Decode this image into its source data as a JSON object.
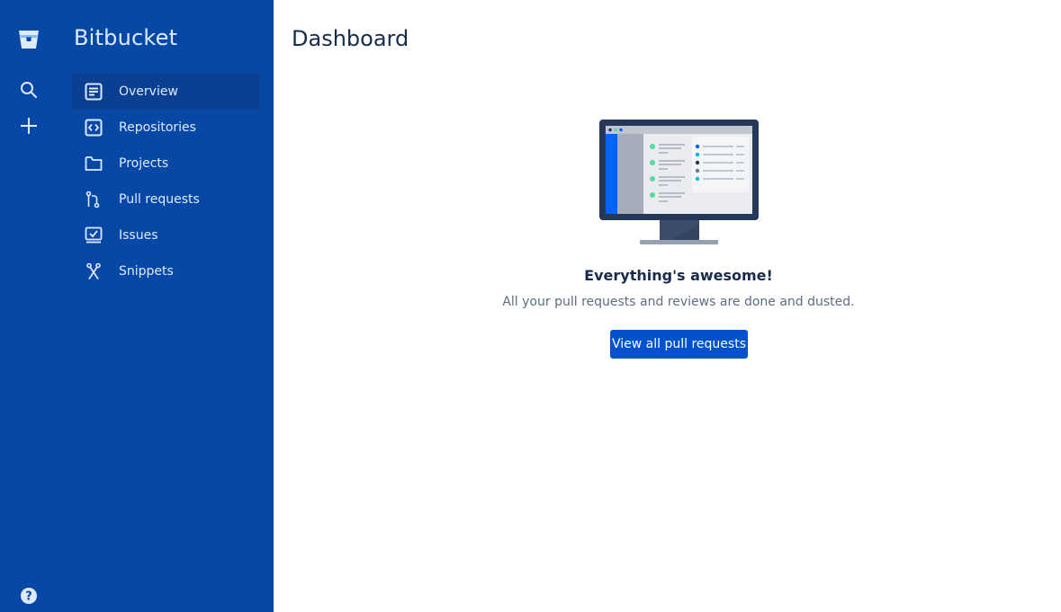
{
  "app": {
    "name": "Bitbucket"
  },
  "global_nav": {
    "icons": [
      "bitbucket-logo-icon",
      "search-icon",
      "create-plus-icon",
      "help-icon"
    ]
  },
  "sidebar": {
    "items": [
      {
        "label": "Overview",
        "icon": "overview-icon",
        "active": true
      },
      {
        "label": "Repositories",
        "icon": "repositories-icon",
        "active": false
      },
      {
        "label": "Projects",
        "icon": "folder-icon",
        "active": false
      },
      {
        "label": "Pull requests",
        "icon": "pull-request-icon",
        "active": false
      },
      {
        "label": "Issues",
        "icon": "issues-icon",
        "active": false
      },
      {
        "label": "Snippets",
        "icon": "snippets-icon",
        "active": false
      }
    ]
  },
  "main": {
    "title": "Dashboard",
    "empty_state": {
      "heading": "Everything's awesome!",
      "description": "All your pull requests and reviews are done and dusted.",
      "button_label": "View all pull requests"
    }
  },
  "colors": {
    "nav_bg": "#0747A6",
    "nav_active": "#0A3F91",
    "nav_text": "#DEEBFF",
    "primary_button": "#0052CC",
    "heading_text": "#172B4D",
    "body_text": "#5E6C84"
  }
}
